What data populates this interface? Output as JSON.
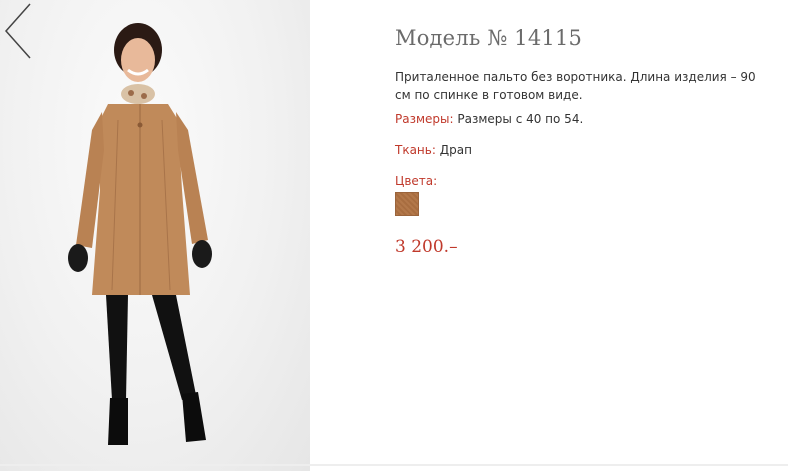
{
  "product": {
    "title": "Модель № 14115",
    "description": "Приталенное пальто без воротника. Длина изделия – 90 см по спинке в готовом виде.",
    "sizes_label": "Размеры:",
    "sizes_value": "Размеры с 40 по 54.",
    "fabric_label": "Ткань:",
    "fabric_value": "Драп",
    "colors_label": "Цвета:",
    "colors": [
      {
        "name": "camel-swatch",
        "hex": "#b3784a"
      }
    ],
    "price": "3 200.–"
  },
  "gallery": {
    "prev_icon": "chevron-left-icon",
    "photo": "model-in-camel-coat"
  },
  "colors": {
    "accent": "#c0392b",
    "title": "#6b6b6b",
    "text": "#333333"
  }
}
